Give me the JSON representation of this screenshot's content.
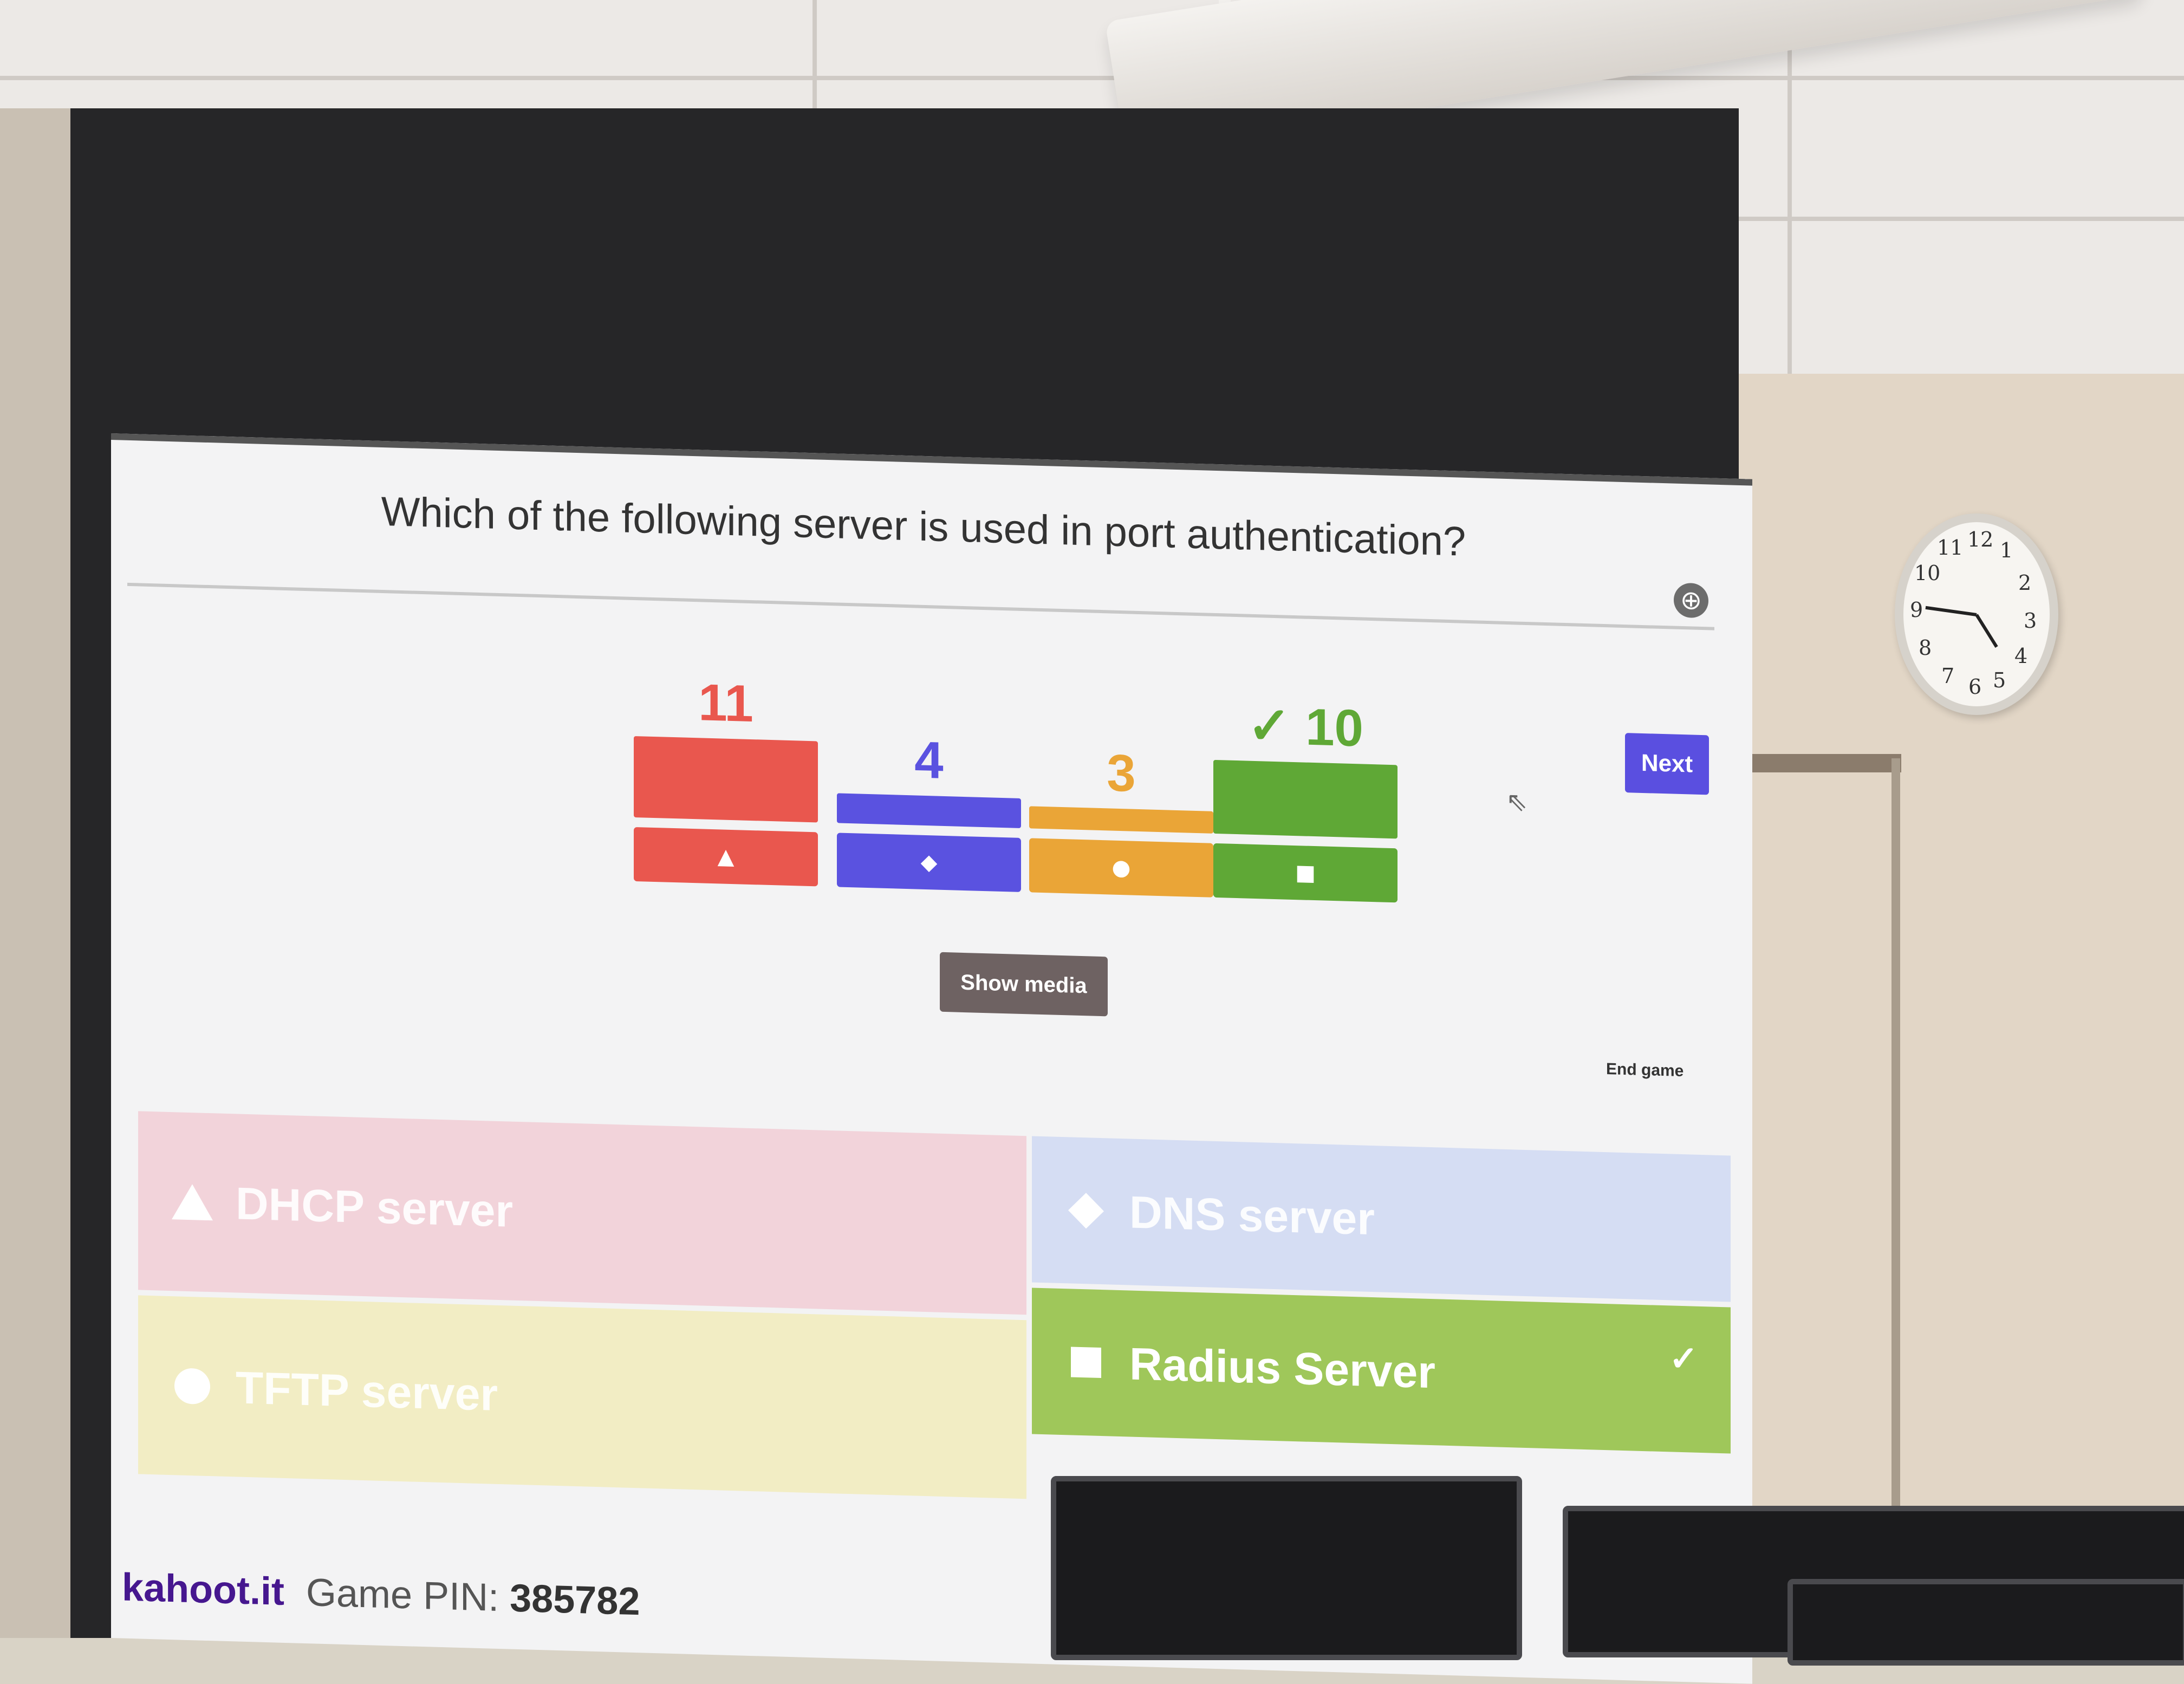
{
  "question": "Which of the following server is used in port authentication?",
  "controls": {
    "fullscreen_icon": "fullscreen-icon",
    "next_label": "Next",
    "show_media_label": "Show media",
    "end_game_label": "End game"
  },
  "results": [
    {
      "count": "11",
      "value": 11,
      "shape": "triangle",
      "color": "#e9574e",
      "correct": false
    },
    {
      "count": "4",
      "value": 4,
      "shape": "diamond",
      "color": "#5a52e0",
      "correct": false
    },
    {
      "count": "3",
      "value": 3,
      "shape": "circle",
      "color": "#eaa537",
      "correct": false
    },
    {
      "count": "✓ 10",
      "value": 10,
      "shape": "square",
      "color": "#5fa836",
      "correct": true
    }
  ],
  "answers": [
    {
      "label": "DHCP server",
      "shape": "triangle",
      "color": "#f2d3da",
      "correct": false
    },
    {
      "label": "DNS server",
      "shape": "diamond",
      "color": "#d5ddf3",
      "correct": false
    },
    {
      "label": "TFTP server",
      "shape": "circle",
      "color": "#f2edc4",
      "correct": false
    },
    {
      "label": "Radius Server",
      "shape": "square",
      "color": "#9fc75a",
      "correct": true,
      "check": "✓"
    }
  ],
  "footer": {
    "brand": "kahoot.it",
    "pin_label": "Game PIN:",
    "pin_value": "385782"
  },
  "clock": {
    "numerals": [
      "12",
      "1",
      "2",
      "3",
      "4",
      "5",
      "6",
      "7",
      "8",
      "9",
      "10",
      "11"
    ]
  }
}
